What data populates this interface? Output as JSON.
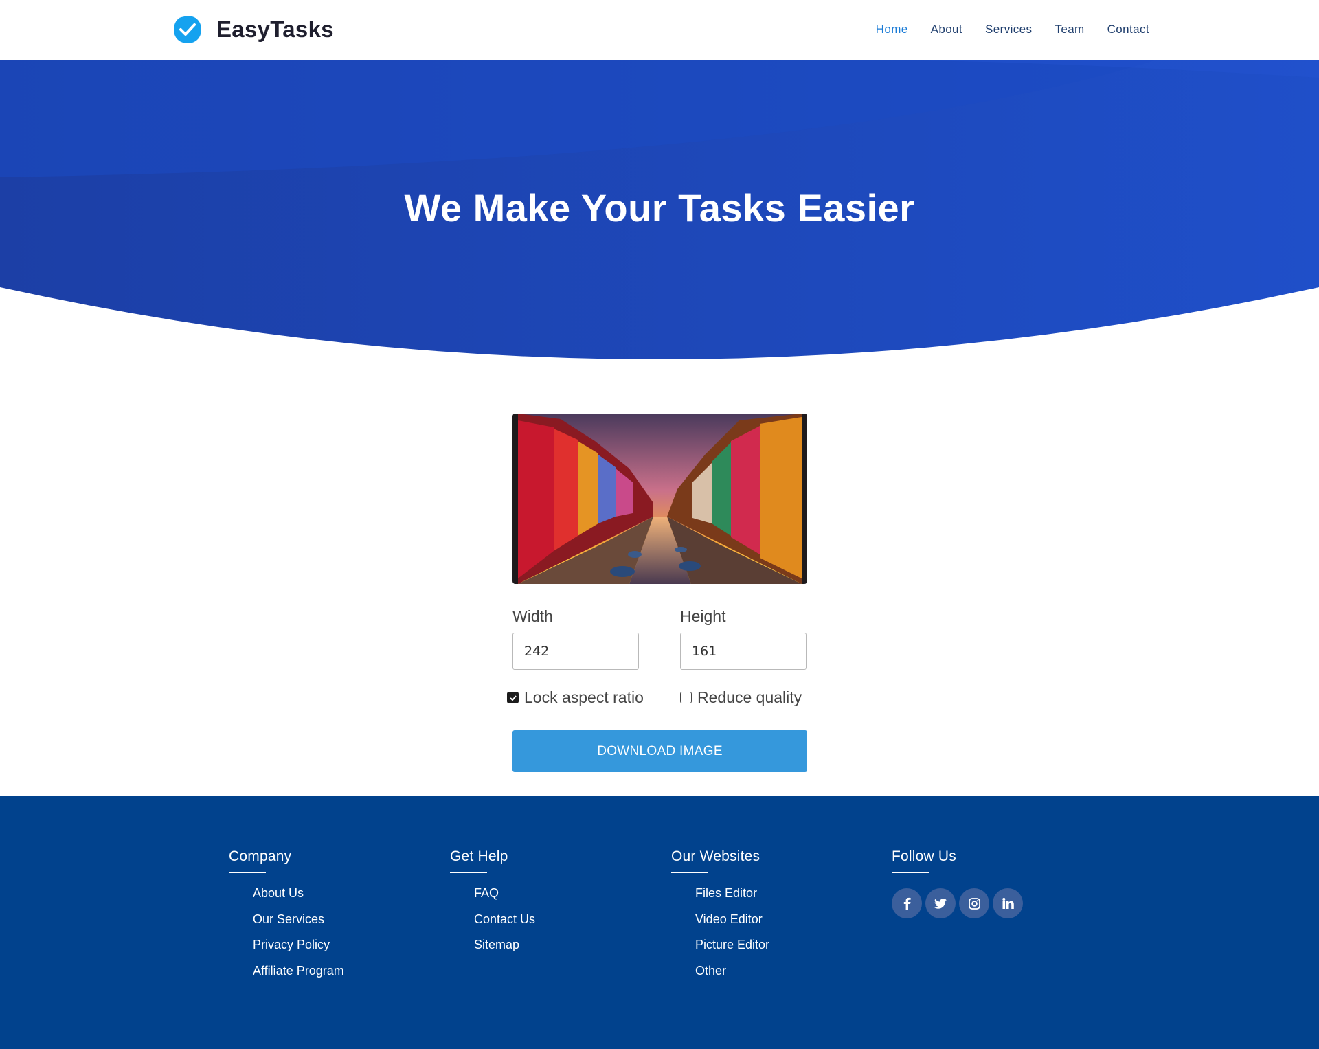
{
  "header": {
    "brand": "EasyTasks",
    "nav": [
      "Home",
      "About",
      "Services",
      "Team",
      "Contact"
    ],
    "active_nav": "Home"
  },
  "hero": {
    "title": "We Make Your Tasks Easier"
  },
  "editor": {
    "image_icon": "canal-sunset-photo",
    "width_label": "Width",
    "width_value": "242",
    "height_label": "Height",
    "height_value": "161",
    "lock_aspect_label": "Lock aspect ratio",
    "lock_aspect_checked": true,
    "reduce_quality_label": "Reduce quality",
    "reduce_quality_checked": false,
    "download_label": "DOWNLOAD IMAGE"
  },
  "footer": {
    "columns": [
      {
        "title": "Company",
        "links": [
          "About Us",
          "Our Services",
          "Privacy Policy",
          "Affiliate Program"
        ]
      },
      {
        "title": "Get Help",
        "links": [
          "FAQ",
          "Contact Us",
          "Sitemap"
        ]
      },
      {
        "title": "Our Websites",
        "links": [
          "Files Editor",
          "Video Editor",
          "Picture Editor",
          "Other"
        ]
      }
    ],
    "follow_title": "Follow Us",
    "social_icons": [
      "facebook-icon",
      "twitter-icon",
      "instagram-icon",
      "linkedin-icon"
    ]
  },
  "colors": {
    "primary_blue": "#1c46b8",
    "nav_active": "#1a7bd6",
    "button": "#3598dc",
    "footer_bg": "#01428d"
  }
}
